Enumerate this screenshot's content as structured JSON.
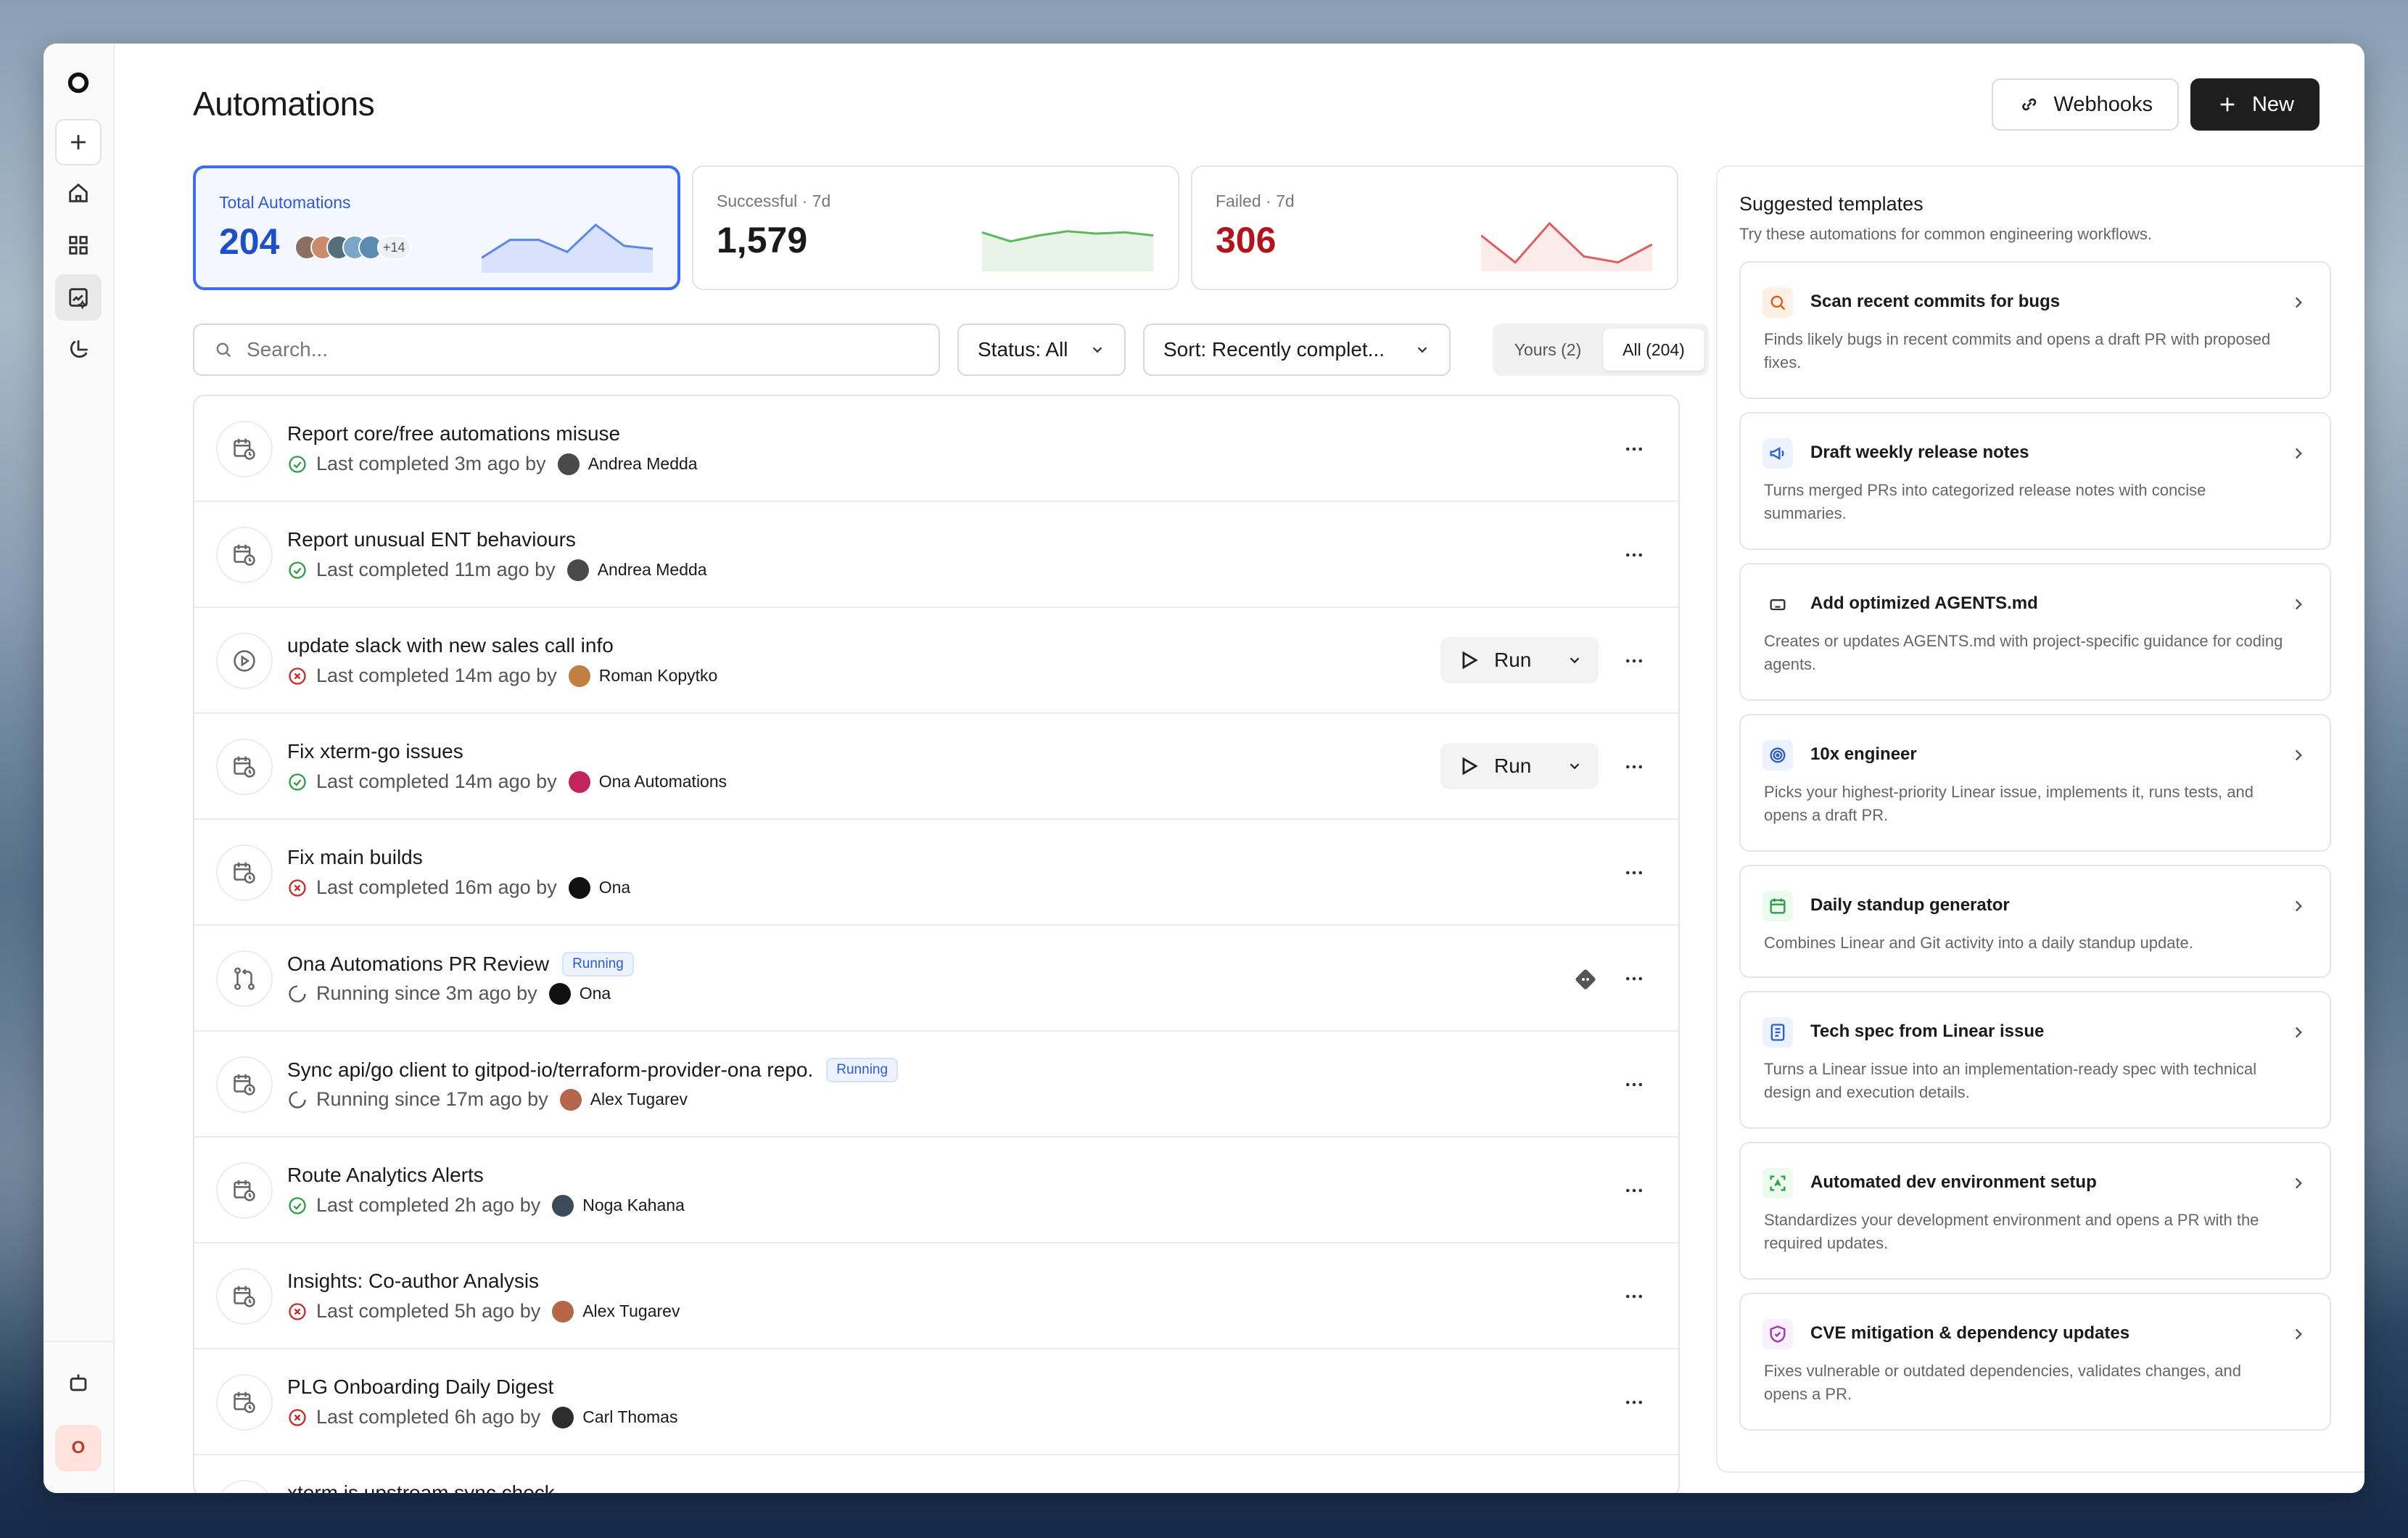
{
  "page": {
    "title": "Automations"
  },
  "header": {
    "webhooks_label": "Webhooks",
    "new_label": "New"
  },
  "sidebar": {
    "avatar_initial": "O"
  },
  "stats": [
    {
      "label": "Total Automations",
      "value": "204",
      "extra_avatars": "+14",
      "trend": [
        0.2,
        0.5,
        0.5,
        0.3,
        0.75,
        0.4,
        0.35
      ]
    },
    {
      "label": "Successful · 7d",
      "value": "1,579",
      "trend": [
        0.6,
        0.45,
        0.55,
        0.62,
        0.58,
        0.6,
        0.55
      ]
    },
    {
      "label": "Failed · 7d",
      "value": "306",
      "trend": [
        0.55,
        0.1,
        0.75,
        0.2,
        0.1,
        0.4
      ]
    }
  ],
  "colors": {
    "accent": "#3b6ef0",
    "success": "#2f9e44",
    "failure": "#c92a2a",
    "running": "#2c5bd8"
  },
  "filters": {
    "search_placeholder": "Search...",
    "status_label": "Status: All",
    "sort_label": "Sort: Recently complet...",
    "yours_label": "Yours (2)",
    "all_label": "All (204)"
  },
  "automations": [
    {
      "title": "Report core/free automations misuse",
      "status": "ok",
      "meta": "Last completed 3m ago by",
      "user": "Andrea Medda",
      "icon": "calendar-clock-icon",
      "has_run": false,
      "running": false
    },
    {
      "title": "Report unusual ENT behaviours",
      "status": "ok",
      "meta": "Last completed 11m ago by",
      "user": "Andrea Medda",
      "icon": "calendar-clock-icon",
      "has_run": false,
      "running": false
    },
    {
      "title": "update slack with new sales call info",
      "status": "fail",
      "meta": "Last completed 14m ago by",
      "user": "Roman Kopytko",
      "icon": "play-circle-icon",
      "has_run": true,
      "running": false
    },
    {
      "title": "Fix xterm-go issues",
      "status": "ok",
      "meta": "Last completed 14m ago by",
      "user": "Ona Automations",
      "icon": "calendar-clock-icon",
      "has_run": true,
      "running": false
    },
    {
      "title": "Fix main builds",
      "status": "fail",
      "meta": "Last completed 16m ago by",
      "user": "Ona",
      "icon": "calendar-clock-icon",
      "has_run": false,
      "running": false
    },
    {
      "title": "Ona Automations PR Review",
      "status": "running",
      "meta": "Running since 3m ago by",
      "user": "Ona",
      "icon": "pull-request-icon",
      "has_run": false,
      "running": true,
      "badge": "Running"
    },
    {
      "title": "Sync api/go client to gitpod-io/terraform-provider-ona repo.",
      "status": "running",
      "meta": "Running since 17m ago by",
      "user": "Alex Tugarev",
      "icon": "calendar-clock-icon",
      "has_run": false,
      "running": true,
      "badge": "Running"
    },
    {
      "title": "Route Analytics Alerts",
      "status": "ok",
      "meta": "Last completed 2h ago by",
      "user": "Noga Kahana",
      "icon": "calendar-clock-icon",
      "has_run": false,
      "running": false
    },
    {
      "title": "Insights: Co-author Analysis",
      "status": "fail",
      "meta": "Last completed 5h ago by",
      "user": "Alex Tugarev",
      "icon": "calendar-clock-icon",
      "has_run": false,
      "running": false
    },
    {
      "title": "PLG Onboarding Daily Digest",
      "status": "fail",
      "meta": "Last completed 6h ago by",
      "user": "Carl Thomas",
      "icon": "calendar-clock-icon",
      "has_run": false,
      "running": false
    },
    {
      "title": "xterm.js upstream sync check",
      "status": "ok",
      "meta": "",
      "user": "",
      "icon": "calendar-clock-icon",
      "has_run": false,
      "running": false
    }
  ],
  "run_label": "Run",
  "templates": {
    "heading": "Suggested templates",
    "subheading": "Try these automations for common engineering workflows.",
    "items": [
      {
        "title": "Scan recent commits for bugs",
        "desc": "Finds likely bugs in recent commits and opens a draft PR with proposed fixes.",
        "icon": "search-icon",
        "color": "#e8590c",
        "bg": "#fff0e6"
      },
      {
        "title": "Draft weekly release notes",
        "desc": "Turns merged PRs into categorized release notes with concise summaries.",
        "icon": "megaphone-icon",
        "color": "#2c5bd8",
        "bg": "#edf2ff"
      },
      {
        "title": "Add optimized AGENTS.md",
        "desc": "Creates or updates AGENTS.md with project-specific guidance for coding agents.",
        "icon": "robot-icon",
        "color": "#333333",
        "bg": "#ffffff"
      },
      {
        "title": "10x engineer",
        "desc": "Picks your highest-priority Linear issue, implements it, runs tests, and opens a draft PR.",
        "icon": "target-icon",
        "color": "#2c5bd8",
        "bg": "#edf2ff"
      },
      {
        "title": "Daily standup generator",
        "desc": "Combines Linear and Git activity into a daily standup update.",
        "icon": "calendar-icon",
        "color": "#2f9e44",
        "bg": "#ebfbee"
      },
      {
        "title": "Tech spec from Linear issue",
        "desc": "Turns a Linear issue into an implementation-ready spec with technical design and execution details.",
        "icon": "document-icon",
        "color": "#2c5bd8",
        "bg": "#edf2ff"
      },
      {
        "title": "Automated dev environment setup",
        "desc": "Standardizes your development environment and opens a PR with the required updates.",
        "icon": "scan-icon",
        "color": "#2f9e44",
        "bg": "#ebfbee"
      },
      {
        "title": "CVE mitigation & dependency updates",
        "desc": "Fixes vulnerable or outdated dependencies, validates changes, and opens a PR.",
        "icon": "shield-icon",
        "color": "#9c36b5",
        "bg": "#f8f0fc"
      }
    ]
  }
}
